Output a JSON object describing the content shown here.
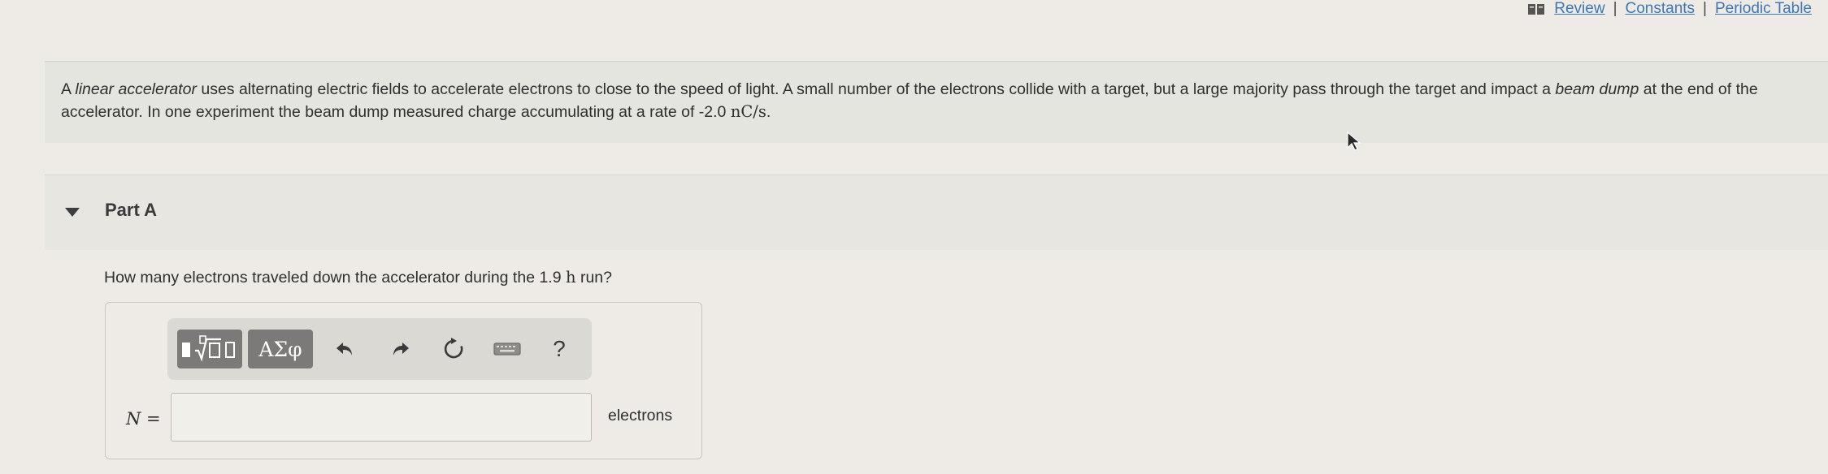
{
  "top_links": {
    "book_icon": "book-icon",
    "review": "Review",
    "constants": "Constants",
    "periodic_table": "Periodic Table",
    "separator": "|"
  },
  "intro": {
    "t1": "A ",
    "em1": "linear accelerator",
    "t2": " uses alternating electric fields to accelerate electrons to close to the speed of light. A small number of the electrons collide with a target, but a large majority pass through the target and impact a ",
    "em2": "beam dump",
    "t3": " at the end of the accelerator. In one experiment the beam dump measured charge accumulating at a rate of -2.0 ",
    "unit": "nC/s",
    "t4": "."
  },
  "part": {
    "title": "Part A",
    "toggle_icon": "caret-down-icon"
  },
  "question": {
    "t1": "How many electrons traveled down the accelerator during the 1.9 ",
    "unit": "h",
    "t2": " run?"
  },
  "toolbar": {
    "templates_icon": "templates-icon",
    "greek_label": "ΑΣφ",
    "undo_icon": "undo-icon",
    "redo_icon": "redo-icon",
    "reset_icon": "reset-icon",
    "keyboard_icon": "keyboard-icon",
    "help_label": "?"
  },
  "answer": {
    "variable": "N",
    "equals": " =",
    "value": "",
    "unit_label": "electrons"
  },
  "colors": {
    "page_bg": "#eeebe6",
    "intro_bg": "#e4e5de",
    "part_bg": "#e7e6e1",
    "link": "#3f76b5",
    "toolbar_btn": "#7b7a78"
  }
}
